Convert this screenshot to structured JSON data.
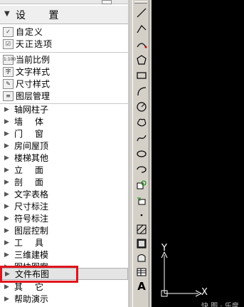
{
  "panel": {
    "title": "设 置",
    "settings_items": [
      {
        "label": "自定义",
        "icon": "custom-icon"
      },
      {
        "label": "天正选项",
        "icon": "options-icon"
      }
    ],
    "style_items": [
      {
        "label": "当前比例",
        "icon": "scale-icon",
        "icon_text": "1:100"
      },
      {
        "label": "文字样式",
        "icon": "text-style-icon",
        "icon_text": "字"
      },
      {
        "label": "尺寸样式",
        "icon": "dim-style-icon",
        "icon_text": "✎"
      },
      {
        "label": "图层管理",
        "icon": "layer-icon",
        "icon_text": "≡"
      }
    ],
    "categories": [
      {
        "label": "轴网柱子",
        "wide": false
      },
      {
        "label": "墙体",
        "wide": true
      },
      {
        "label": "门窗",
        "wide": true
      },
      {
        "label": "房间屋顶",
        "wide": false
      },
      {
        "label": "楼梯其他",
        "wide": false
      },
      {
        "label": "立面",
        "wide": true
      },
      {
        "label": "剖面",
        "wide": true
      },
      {
        "label": "文字表格",
        "wide": false
      },
      {
        "label": "尺寸标注",
        "wide": false
      },
      {
        "label": "符号标注",
        "wide": false
      },
      {
        "label": "图层控制",
        "wide": false
      },
      {
        "label": "工具",
        "wide": true
      },
      {
        "label": "三维建模",
        "wide": false
      },
      {
        "label": "图块图案",
        "wide": false
      },
      {
        "label": "文件布图",
        "wide": false,
        "selected": true
      },
      {
        "label": "其它",
        "wide": true
      },
      {
        "label": "帮助演示",
        "wide": false
      }
    ],
    "highlight_color": "#e0141c"
  },
  "toolbar": {
    "tools": [
      "line-icon",
      "polyline-icon",
      "arc-path-icon",
      "polygon-icon",
      "rectangle-icon",
      "arc-icon",
      "circle-icon",
      "revision-cloud-icon",
      "spline-icon",
      "ellipse-icon",
      "ellipse-arc-icon",
      "insert-block-icon",
      "make-block-icon",
      "point-icon",
      "hatch-icon",
      "gradient-icon",
      "region-icon",
      "table-icon",
      "mtext-icon"
    ],
    "mtext_glyph": "A"
  },
  "canvas": {
    "background": "#000000",
    "axis_y": "Y",
    "axis_x": "X",
    "watermark": "快 图 · 乐度"
  }
}
